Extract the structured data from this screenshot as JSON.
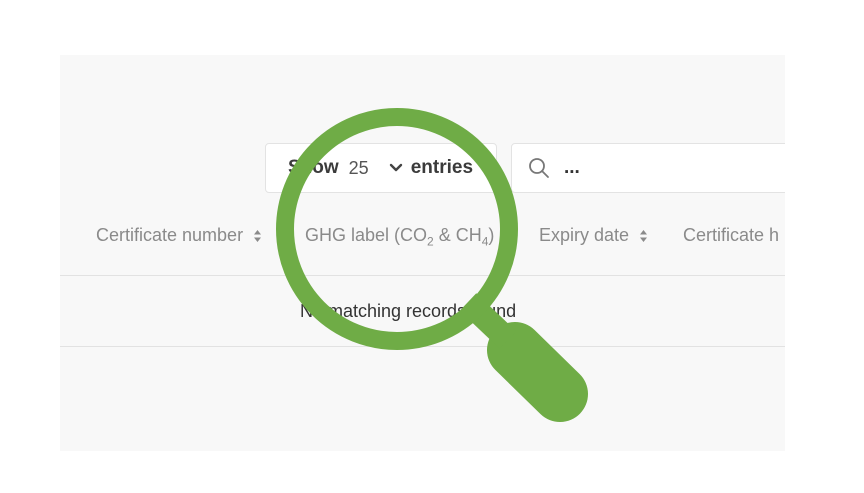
{
  "length_control": {
    "show_label": "Show",
    "selected_value": "25",
    "entries_label": "entries"
  },
  "search": {
    "placeholder": "..."
  },
  "table": {
    "headers": [
      {
        "label": "Certificate number"
      },
      {
        "label_prefix": "GHG label (CO",
        "sub1": "2",
        "label_mid": " & CH",
        "sub2": "4",
        "label_suffix": ")"
      },
      {
        "label": "Expiry date"
      },
      {
        "label": "Certificate h"
      }
    ],
    "empty_message": "No matching records found"
  },
  "colors": {
    "magnifier": "#6fac46",
    "panel_bg": "#f8f8f8",
    "header_text": "#8a8a8a"
  },
  "icons": [
    "chevron-down-icon",
    "search-icon",
    "sort-icon",
    "magnifying-glass-icon"
  ]
}
